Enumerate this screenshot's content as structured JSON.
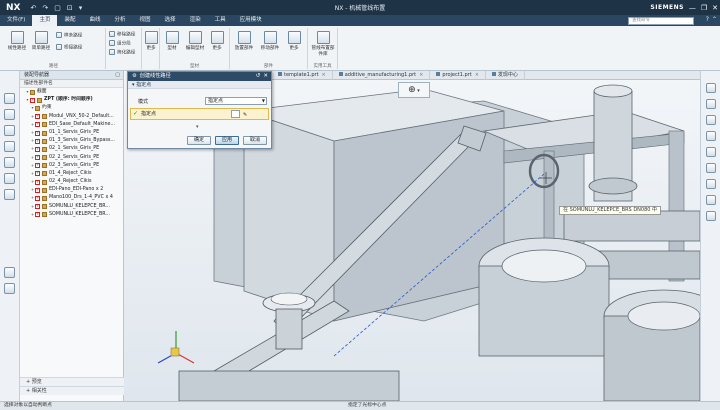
{
  "app": {
    "logo": "NX",
    "window_title": "NX - 机械管线布置",
    "brand": "SIEMENS",
    "quick_access": [
      "↶",
      "↷",
      "▢",
      "⊡",
      "▾"
    ],
    "window_controls": [
      "—",
      "❐",
      "✕"
    ]
  },
  "menubar": {
    "tabs": [
      "文件(F)",
      "主页",
      "装配",
      "曲线",
      "分析",
      "视图",
      "选择",
      "渲染",
      "工具",
      "应用模块"
    ],
    "active_index": 1,
    "search_placeholder": "查找命令"
  },
  "ribbon": {
    "groups": [
      {
        "label": "路径",
        "buttons": [
          "线性路径",
          "简单路径",
          "样条路径",
          "桥接路径"
        ],
        "small": [
          "移除路径",
          "组分段",
          "简化路径"
        ]
      },
      {
        "label": "",
        "buttons": [
          "更多"
        ]
      },
      {
        "label": "型材",
        "buttons": [
          "型材",
          "编辑型材",
          "更多"
        ]
      },
      {
        "label": "部件",
        "buttons": [
          "放置部件",
          "移动部件",
          "更多"
        ]
      },
      {
        "label": "实用工具",
        "buttons": [
          "管线布置部件库"
        ]
      }
    ]
  },
  "navigator": {
    "title": "装配导航器",
    "column_header": "描述性部件名",
    "items": [
      {
        "label": "截面",
        "indent": 1,
        "type": "folder"
      },
      {
        "label": "ZPT (顺序: 时间顺序)",
        "indent": 1,
        "type": "assembly",
        "bold": true
      },
      {
        "label": "约束",
        "indent": 2,
        "type": "folder"
      },
      {
        "label": "Modul_VNX_50-2_Default...",
        "indent": 2,
        "type": "part"
      },
      {
        "label": "EDI_Sase_Default_Makine...",
        "indent": 2,
        "type": "part"
      },
      {
        "label": "01_1_Servis_Giris_PE",
        "indent": 2,
        "type": "part"
      },
      {
        "label": "01_3_Servis_Giris_Bypass...",
        "indent": 2,
        "type": "part"
      },
      {
        "label": "02_1_Servis_Giris_PE",
        "indent": 2,
        "type": "part"
      },
      {
        "label": "02_2_Servis_Giris_PE",
        "indent": 2,
        "type": "part"
      },
      {
        "label": "02_3_Servis_Giris_PE",
        "indent": 2,
        "type": "part"
      },
      {
        "label": "01_4_Reject_Cikis",
        "indent": 2,
        "type": "part"
      },
      {
        "label": "02_4_Reject_Cikis",
        "indent": 2,
        "type": "part"
      },
      {
        "label": "EDI-Pano_EDI-Pano x 2",
        "indent": 2,
        "type": "part"
      },
      {
        "label": "Mano100_Drs_1-4_PVC x 4",
        "indent": 2,
        "type": "part"
      },
      {
        "label": "SOMUNLU_KELEPCE_BR...",
        "indent": 2,
        "type": "part"
      },
      {
        "label": "SOMUNLU_KELEPCE_BR...",
        "indent": 2,
        "type": "part"
      }
    ],
    "footer": [
      "预览",
      "相关性"
    ]
  },
  "doc_tabs": [
    {
      "label": "template1.prt"
    },
    {
      "label": "additive_manufacturing1.prt"
    },
    {
      "label": "project1.prt"
    },
    {
      "label": "发现中心"
    }
  ],
  "dialog": {
    "title": "创建线性路径",
    "section": "指定点",
    "mode_label": "模式",
    "mode_value": "指定点",
    "pick_label": "指定点",
    "ok": "确定",
    "apply": "应用",
    "cancel": "取消"
  },
  "tooltip": "在 SOMUNLU_KELEPCE_BRS DN080 中",
  "status": {
    "left": "选择对象以自动判断点",
    "center": "指定了光标中心点"
  }
}
